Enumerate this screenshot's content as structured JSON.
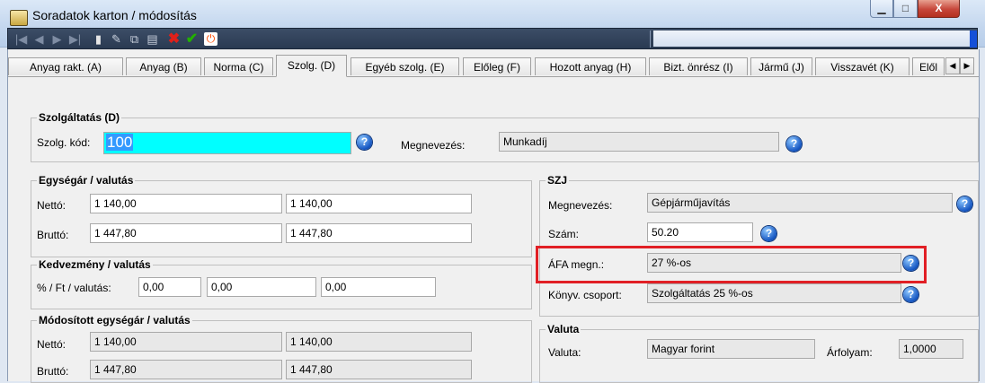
{
  "window": {
    "title": "Soradatok karton / módosítás",
    "min_glyph": "▁",
    "max_glyph": "□",
    "close_glyph": "X"
  },
  "toolbar": {
    "nav_first": "|◀",
    "nav_prev": "◀",
    "nav_next": "▶",
    "nav_last": "▶|",
    "new_glyph": "▮",
    "edit_glyph": "✎",
    "copy_glyph": "⧉",
    "paste_glyph": "▤",
    "delete_glyph": "✖",
    "ok_glyph": "✔",
    "power_glyph": "⏻",
    "delete_color": "#e0201a",
    "ok_color": "#22b000",
    "power_color": "#ff4a00"
  },
  "tabs": [
    "Anyag rakt. (A)",
    "Anyag (B)",
    "Norma (C)",
    "Szolg. (D)",
    "Egyéb szolg. (E)",
    "Előleg (F)",
    "Hozott anyag (H)",
    "Bizt. önrész (I)",
    "Jármű (J)",
    "Visszavét (K)",
    "Elől"
  ],
  "active_tab_index": 3,
  "szolgaltatas": {
    "title": "Szolgáltatás (D)",
    "kod_label": "Szolg. kód:",
    "kod_value": "100",
    "megnevezes_label": "Megnevezés:",
    "megnevezes_value": "Munkadíj"
  },
  "egysegar": {
    "title": "Egységár / valutás",
    "netto_label": "Nettó:",
    "netto_value": "1 140,00",
    "netto_valutas": "1 140,00",
    "brutto_label": "Bruttó:",
    "brutto_value": "1 447,80",
    "brutto_valutas": "1 447,80"
  },
  "kedvezmeny": {
    "title": "Kedvezmény / valutás",
    "label": "% / Ft / valutás:",
    "percent": "0,00",
    "ft": "0,00",
    "valutas": "0,00"
  },
  "modositott": {
    "title": "Módosított egységár / valutás",
    "netto_label": "Nettó:",
    "netto_value": "1 140,00",
    "netto_valutas": "1 140,00",
    "brutto_label": "Bruttó:",
    "brutto_value": "1 447,80",
    "brutto_valutas": "1 447,80"
  },
  "szj": {
    "title": "SZJ",
    "megnevezes_label": "Megnevezés:",
    "megnevezes_value": "Gépjárműjavítás",
    "szam_label": "Szám:",
    "szam_value": "50.20",
    "afa_label": "ÁFA megn.:",
    "afa_value": "27 %-os",
    "konyv_label": "Könyv. csoport:",
    "konyv_value": "Szolgáltatás 25 %-os"
  },
  "valuta": {
    "title": "Valuta",
    "valuta_label": "Valuta:",
    "valuta_value": "Magyar forint",
    "arfolyam_label": "Árfolyam:",
    "arfolyam_value": "1,0000"
  },
  "help_glyph": "?",
  "highlight_color": "#e11f25"
}
